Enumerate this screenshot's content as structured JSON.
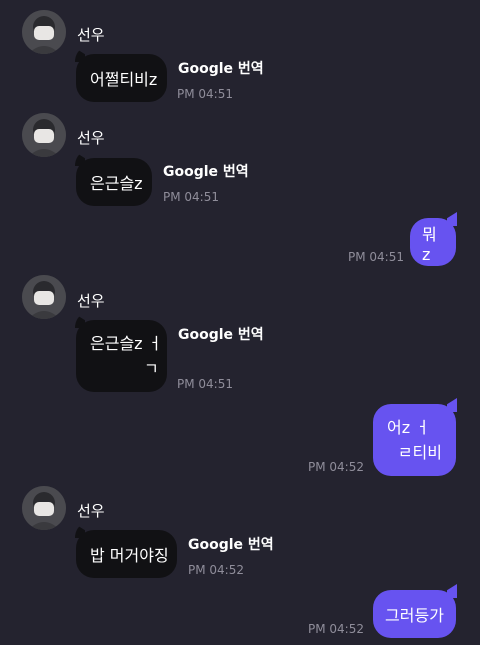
{
  "messages": [
    {
      "type": "incoming",
      "sender": "선우",
      "text": "어쩔티비z",
      "translate_label": "Google 번역",
      "time": "PM 04:51"
    },
    {
      "type": "incoming",
      "sender": "선우",
      "text": "은근슬z",
      "translate_label": "Google 번역",
      "time": "PM 04:51"
    },
    {
      "type": "outgoing",
      "text": "뭐z",
      "time": "PM 04:51"
    },
    {
      "type": "incoming",
      "sender": "선우",
      "lines": [
        "은근슬z ㅓ",
        "ㄱ"
      ],
      "translate_label": "Google 번역",
      "time": "PM 04:51"
    },
    {
      "type": "outgoing",
      "lines": [
        "어z ㅓ",
        "ㄹ티비"
      ],
      "time": "PM 04:52"
    },
    {
      "type": "incoming",
      "sender": "선우",
      "text": "밥 머거야징",
      "translate_label": "Google 번역",
      "time": "PM 04:52"
    },
    {
      "type": "outgoing",
      "text": "그러등가",
      "time": "PM 04:52"
    }
  ],
  "colors": {
    "background": "#24232f",
    "incoming_bubble": "#111114",
    "outgoing_bubble": "#6753f0",
    "timestamp": "#8f8d9a"
  }
}
